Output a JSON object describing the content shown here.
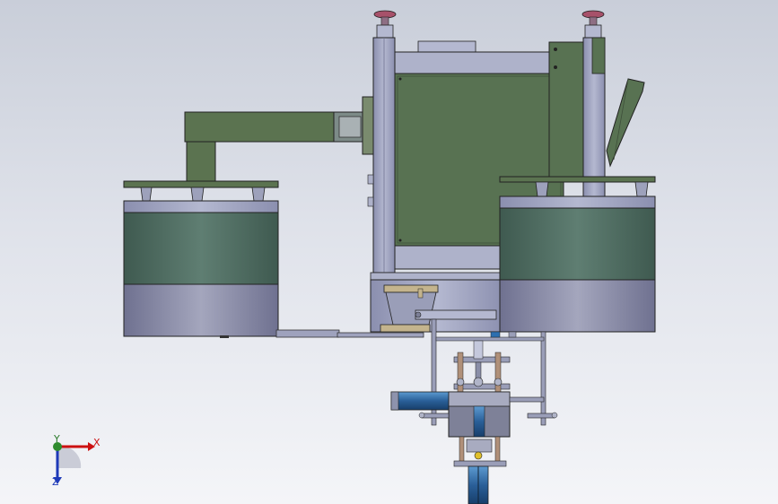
{
  "view": {
    "background_top": "#c9ced9",
    "background_bottom": "#f4f5f8"
  },
  "colors": {
    "frame_steel": "#a3a7c3",
    "panel_green": "#5a7050",
    "drum_green": "#4e6a5f",
    "drum_base": "#8a8ca4",
    "cylinder_blue": "#2d6fb0",
    "outline": "#2a2a33"
  },
  "triad": {
    "x_label": "X",
    "y_label": "Y",
    "z_label": "Z",
    "x_color": "#cc1111",
    "y_color": "#2e8b2e",
    "z_color": "#1e3ab8"
  }
}
